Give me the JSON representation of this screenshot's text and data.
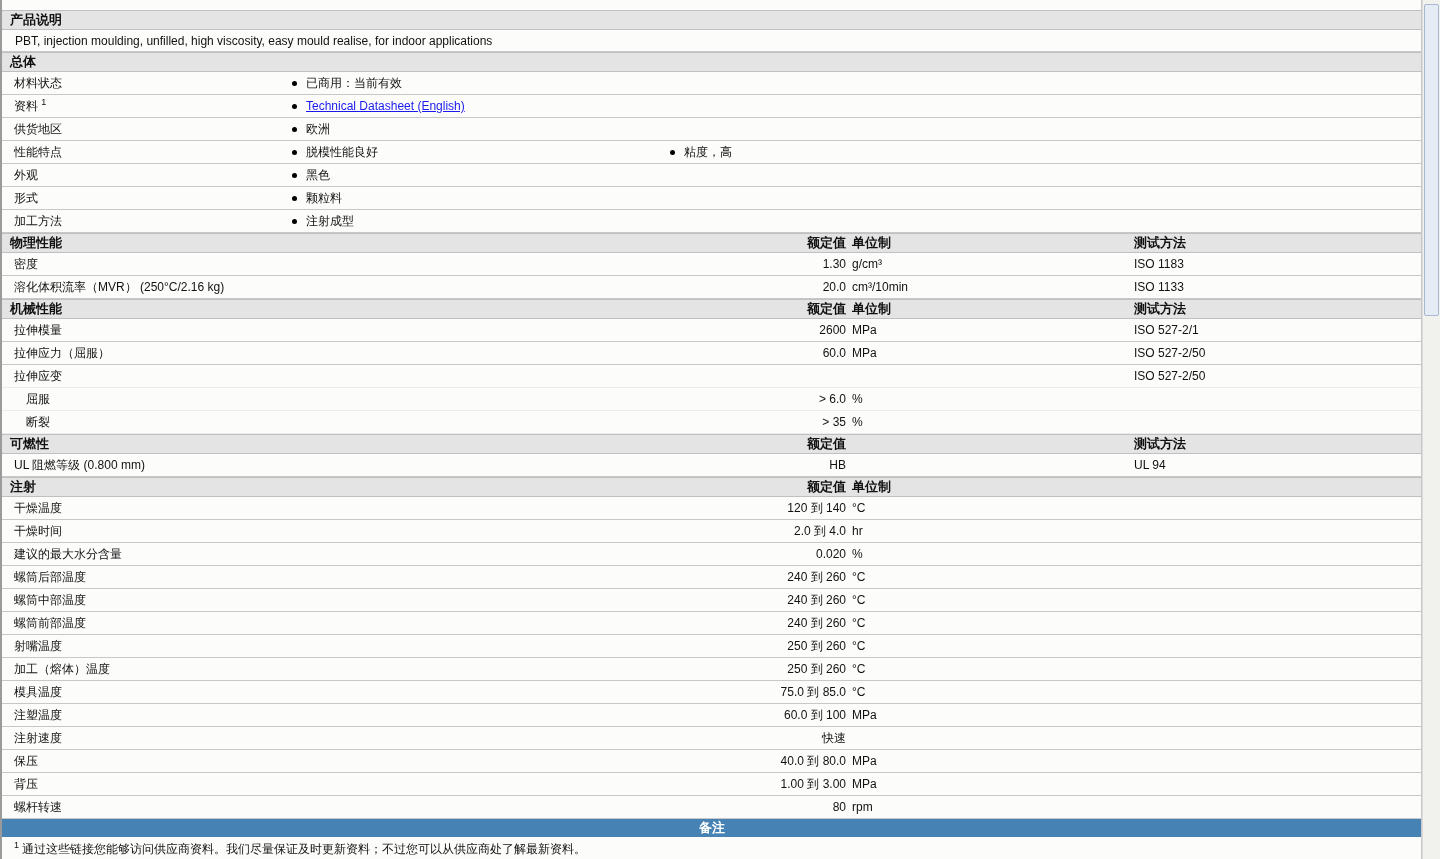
{
  "sections": [
    {
      "kind": "text",
      "title": "产品说明",
      "text": "PBT, injection moulding, unfilled, high viscosity, easy mould realise, for indoor applications"
    },
    {
      "kind": "list",
      "title": "总体",
      "rows": [
        {
          "name": "材料状态",
          "items": [
            {
              "kind": "plain",
              "text": "已商用：当前有效"
            }
          ]
        },
        {
          "name": "资料 $^{1}$",
          "items": [
            {
              "kind": "link",
              "text": "Technical Datasheet (English)"
            }
          ]
        },
        {
          "name": "供货地区",
          "items": [
            {
              "kind": "plain",
              "text": "欧洲"
            }
          ]
        },
        {
          "name": "性能特点",
          "items": [
            {
              "kind": "plain",
              "text": "脱模性能良好"
            },
            {
              "kind": "plain",
              "text": "粘度，高"
            }
          ]
        },
        {
          "name": "外观",
          "items": [
            {
              "kind": "plain",
              "text": "黑色"
            }
          ]
        },
        {
          "name": "形式",
          "items": [
            {
              "kind": "plain",
              "text": "颗粒料"
            }
          ]
        },
        {
          "name": "加工方法",
          "items": [
            {
              "kind": "plain",
              "text": "注射成型"
            }
          ]
        }
      ]
    },
    {
      "kind": "props",
      "title": "物理性能",
      "value_header": "额定值",
      "unit_header": "单位制",
      "method_header": "测试方法",
      "rows": [
        {
          "name": "密度",
          "value": "1.30",
          "unit": "g/cm³",
          "method": "ISO 1183"
        },
        {
          "name": "溶化体积流率（MVR） (250°C/2.16 kg)",
          "value": "20.0",
          "unit": "cm³/10min",
          "method": "ISO 1133"
        }
      ]
    },
    {
      "kind": "props",
      "title": "机械性能",
      "value_header": "额定值",
      "unit_header": "单位制",
      "method_header": "测试方法",
      "rows": [
        {
          "name": "拉伸模量",
          "value": "2600",
          "unit": "MPa",
          "method": "ISO 527-2/1"
        },
        {
          "name": "拉伸应力（屈服）",
          "value": "60.0",
          "unit": "MPa",
          "method": "ISO 527-2/50"
        },
        {
          "name": "拉伸应变",
          "method": "ISO 527-2/50",
          "children": [
            {
              "name": "屈服",
              "value": "> 6.0",
              "unit": "%"
            },
            {
              "name": "断裂",
              "value": "> 35",
              "unit": "%"
            }
          ]
        }
      ]
    },
    {
      "kind": "props",
      "title": "可燃性",
      "value_header": "额定值",
      "method_header": "测试方法",
      "rows": [
        {
          "name": "UL 阻燃等级 (0.800 mm)",
          "value": "HB",
          "method": "UL 94"
        }
      ]
    },
    {
      "kind": "props",
      "title": "注射",
      "value_header": "额定值",
      "unit_header": "单位制",
      "rows": [
        {
          "name": "干燥温度",
          "value": "120 到  140",
          "unit": "°C"
        },
        {
          "name": "干燥时间",
          "value": "2.0 到  4.0",
          "unit": "hr"
        },
        {
          "name": "建议的最大水分含量",
          "value": "0.020",
          "unit": "%"
        },
        {
          "name": "螺筒后部温度",
          "value": "240 到  260",
          "unit": "°C"
        },
        {
          "name": "螺筒中部温度",
          "value": "240 到  260",
          "unit": "°C"
        },
        {
          "name": "螺筒前部温度",
          "value": "240 到  260",
          "unit": "°C"
        },
        {
          "name": "射嘴温度",
          "value": "250 到  260",
          "unit": "°C"
        },
        {
          "name": "加工（熔体）温度",
          "value": "250 到  260",
          "unit": "°C"
        },
        {
          "name": "模具温度",
          "value": "75.0 到  85.0",
          "unit": "°C"
        },
        {
          "name": "注塑温度",
          "value": "60.0 到  100",
          "unit": "MPa"
        },
        {
          "name": "注射速度",
          "value": "快速"
        },
        {
          "name": "保压",
          "value": "40.0 到  80.0",
          "unit": "MPa"
        },
        {
          "name": "背压",
          "value": "1.00 到  3.00",
          "unit": "MPa"
        },
        {
          "name": "螺杆转速",
          "value": "80",
          "unit": "rpm"
        }
      ]
    },
    {
      "kind": "notes",
      "title": "备注",
      "text": "$^{1}$ 通过这些链接您能够访问供应商资料。我们尽量保证及时更新资料；不过您可以从供应商处了解最新资料。"
    }
  ]
}
